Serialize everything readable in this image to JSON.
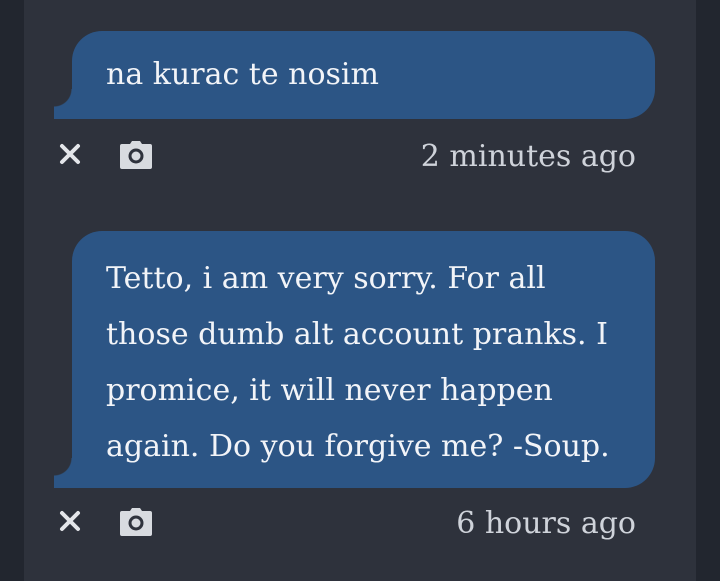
{
  "messages": [
    {
      "text": "na kurac te nosim",
      "time": "2 minutes ago"
    },
    {
      "lines": [
        "Tetto, i am very sorry. For all",
        "those dumb alt account pranks. I",
        "promice, it will never happen",
        "again. Do you forgive me? -Soup."
      ],
      "time": "6 hours ago"
    }
  ],
  "icons": {
    "delete": "close-icon",
    "screenshot": "camera-icon"
  },
  "colors": {
    "bubble": "#2c5585",
    "background": "#2e323c",
    "text": "#f2f4f8",
    "meta": "#cfd3da"
  }
}
